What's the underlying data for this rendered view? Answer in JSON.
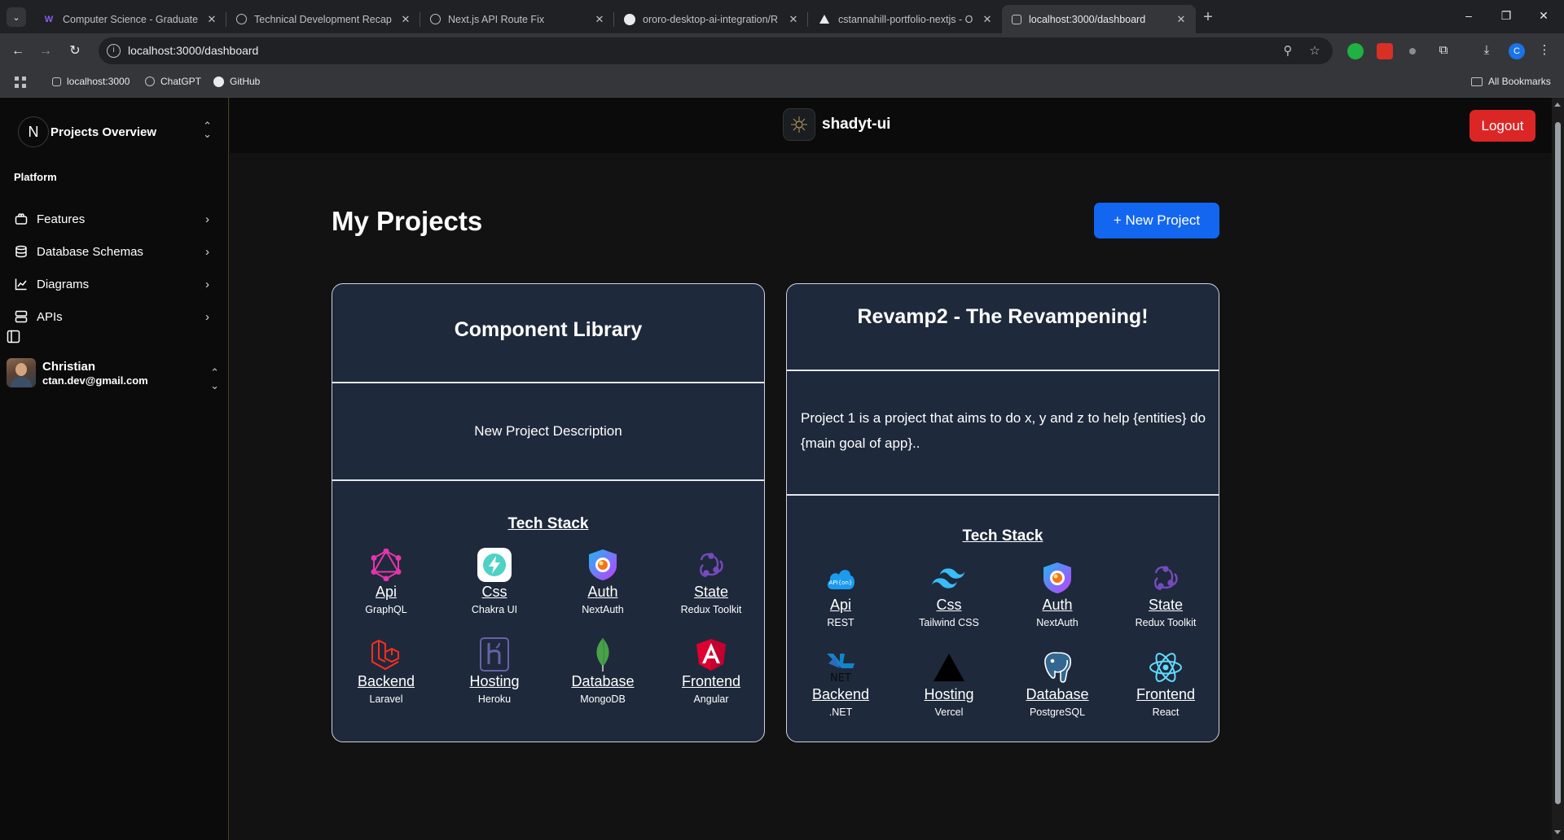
{
  "browser": {
    "tabs": [
      {
        "label": "Computer Science - Graduate P",
        "icon": "w-icon",
        "active": false
      },
      {
        "label": "Technical Development Recap",
        "icon": "chatgpt-icon",
        "active": false
      },
      {
        "label": "Next.js API Route Fix",
        "icon": "chatgpt-icon",
        "active": false
      },
      {
        "label": "ororo-desktop-ai-integration/R",
        "icon": "github-icon",
        "active": false
      },
      {
        "label": "cstannahill-portfolio-nextjs - O",
        "icon": "vercel-icon",
        "active": false
      },
      {
        "label": "localhost:3000/dashboard",
        "icon": "localhost-icon",
        "active": true
      }
    ],
    "url": "localhost:3000/dashboard",
    "profile_initial": "C",
    "bookmarks": [
      {
        "label": "localhost:3000"
      },
      {
        "label": "ChatGPT"
      },
      {
        "label": "GitHub"
      }
    ],
    "all_bookmarks_label": "All Bookmarks"
  },
  "sidebar": {
    "team_initial": "N",
    "team_name": "Projects Overview",
    "group_label": "Platform",
    "items": [
      {
        "label": "Features",
        "icon": "features-icon"
      },
      {
        "label": "Database Schemas",
        "icon": "database-icon"
      },
      {
        "label": "Diagrams",
        "icon": "chart-icon"
      },
      {
        "label": "APIs",
        "icon": "server-icon"
      }
    ],
    "user": {
      "name": "Christian",
      "email": "ctan.dev@gmail.com"
    }
  },
  "header": {
    "brand": "shadyt-ui",
    "logout_label": "Logout"
  },
  "main": {
    "title": "My Projects",
    "new_project_label": "+ New Project",
    "projects": [
      {
        "title": "Component Library",
        "description": "New Project Description",
        "tech_stack_label": "Tech Stack",
        "stack": [
          {
            "category": "Api",
            "name": "GraphQL",
            "icon": "graphql-icon"
          },
          {
            "category": "Css",
            "name": "Chakra UI",
            "icon": "chakra-icon"
          },
          {
            "category": "Auth",
            "name": "NextAuth",
            "icon": "nextauth-icon"
          },
          {
            "category": "State",
            "name": "Redux Toolkit",
            "icon": "redux-icon"
          },
          {
            "category": "Backend",
            "name": "Laravel",
            "icon": "laravel-icon"
          },
          {
            "category": "Hosting",
            "name": "Heroku",
            "icon": "heroku-icon"
          },
          {
            "category": "Database",
            "name": "MongoDB",
            "icon": "mongodb-icon"
          },
          {
            "category": "Frontend",
            "name": "Angular",
            "icon": "angular-icon"
          }
        ]
      },
      {
        "title": "Revamp2 - The Revampening!",
        "description": "Project 1 is a project that aims to do x, y and z to help {entities} do {main goal of app}..",
        "tech_stack_label": "Tech Stack",
        "stack": [
          {
            "category": "Api",
            "name": "REST",
            "icon": "rest-api-icon"
          },
          {
            "category": "Css",
            "name": "Tailwind CSS",
            "icon": "tailwind-icon"
          },
          {
            "category": "Auth",
            "name": "NextAuth",
            "icon": "nextauth-icon"
          },
          {
            "category": "State",
            "name": "Redux Toolkit",
            "icon": "redux-icon"
          },
          {
            "category": "Backend",
            "name": ".NET",
            "icon": "dotnet-icon"
          },
          {
            "category": "Hosting",
            "name": "Vercel",
            "icon": "vercel-icon"
          },
          {
            "category": "Database",
            "name": "PostgreSQL",
            "icon": "postgresql-icon"
          },
          {
            "category": "Frontend",
            "name": "React",
            "icon": "react-icon"
          }
        ]
      }
    ]
  },
  "colors": {
    "accent_blue": "#1366f0",
    "logout_red": "#dc2626",
    "card_bg": "#1e293b",
    "app_bg": "#121212"
  }
}
